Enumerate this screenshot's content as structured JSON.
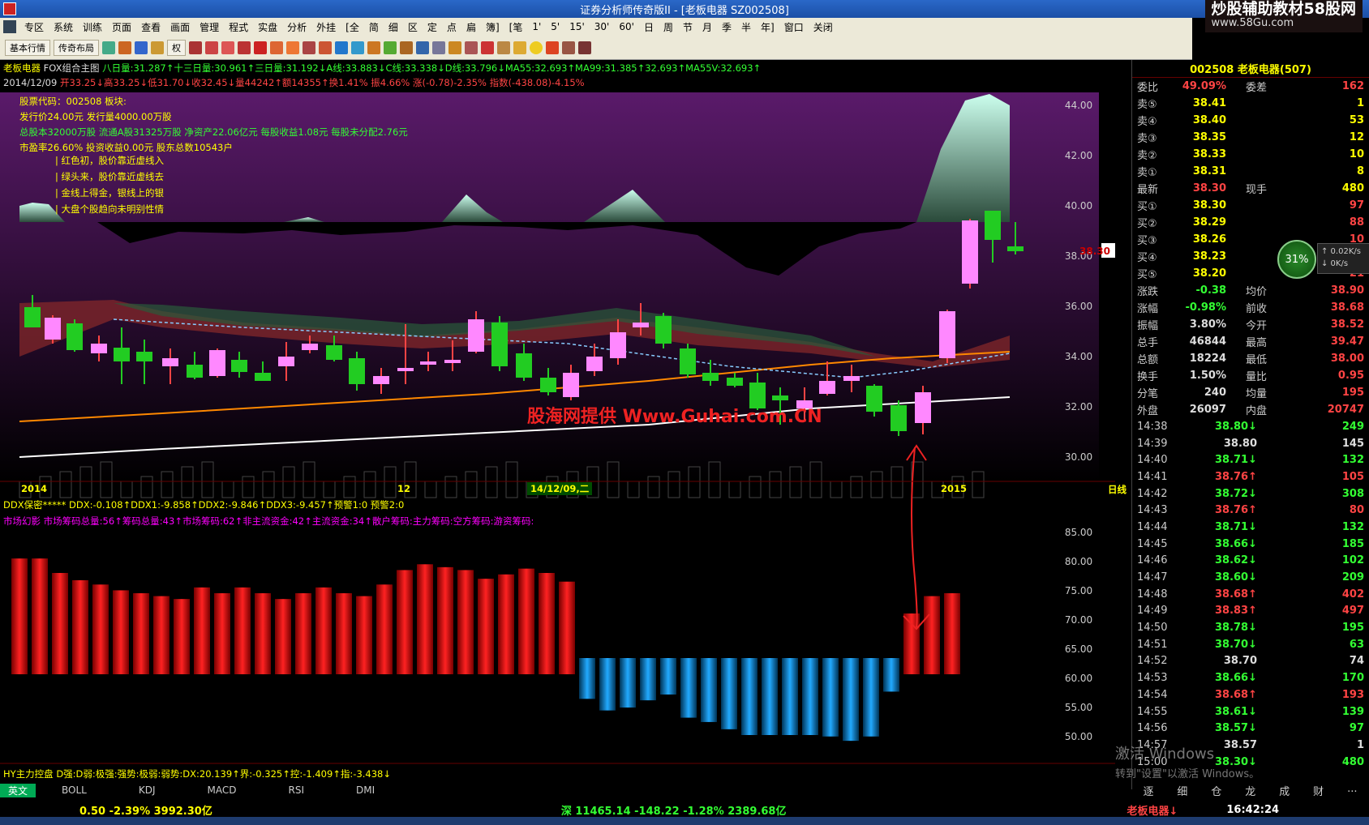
{
  "window": {
    "title": "证券分析师传奇版II - [老板电器 SZ002508]"
  },
  "watermark": {
    "line1": "炒股辅助教材58股网",
    "line2": "www.58Gu.com"
  },
  "menu": [
    "专区",
    "系统",
    "训练",
    "页面",
    "查看",
    "画面",
    "管理",
    "程式",
    "实盘",
    "分析",
    "外挂",
    "[全",
    "简",
    "细",
    "区",
    "定",
    "点",
    "扁",
    "簿]",
    "[笔",
    "1'",
    "5'",
    "15'",
    "30'",
    "60'",
    "日",
    "周",
    "节",
    "月",
    "季",
    "半",
    "年]",
    "窗口",
    "关闭"
  ],
  "toolbar": {
    "basic_label": "基本行情",
    "layout_label": "传奇布局",
    "quan_label": "权"
  },
  "chart_header": {
    "stock_name": "老板电器",
    "indicator_name": "FOX组合主图",
    "ma_line": "八日量:31.287↑十三日量:30.961↑三日量:31.192↓A线:33.883↓C线:33.338↓D线:33.796↓MA55:32.693↑MA99:31.385↑32.693↑MA55V:32.693↑",
    "date": "2014/12/09",
    "ohlc": "开33.25↓高33.25↓低31.70↓收32.45↓量44242↑额14355↑换1.41% 振4.66% 涨(-0.78)-2.35% 指数(-438.08)-4.15%"
  },
  "stock_info": {
    "code_line": "股票代码：002508 板块:",
    "issue_line": "发行价24.00元   发行量4000.00万股",
    "capital_line": "总股本32000万股   流通A股31325万股   净资产22.06亿元   每股收益1.08元   每股未分配2.76元",
    "pe_line": "市盈率26.60%   投资收益0.00元   股东总数10543户"
  },
  "tips": [
    "红色初，股价靠近虚线入",
    "绿头来，股价靠近虚线去",
    "金线上得金，银线上的银",
    "大盘个股趋向未明别性情"
  ],
  "site_watermark": "股海网提供 Www.Guhai.com.CN",
  "price_axis": [
    "44.00",
    "42.00",
    "40.00",
    "38.00",
    "36.00",
    "34.00",
    "32.00",
    "30.00"
  ],
  "current_price_tag": "38.30",
  "date_axis": {
    "left": "2014",
    "mid": "12",
    "cursor": "14/12/09,二",
    "right": "2015",
    "period": "日线"
  },
  "ddx_header": "DDX保密*****  DDX:-0.108↑DDX1:-9.858↑DDX2:-9.846↑DDX3:-9.457↑预警1:0 预警2:0",
  "market_header": "市场幻影 市场筹码总量:56↑筹码总量:43↑市场筹码:62↑非主流资金:42↑主流资金:34↑散户筹码:主力筹码:空方筹码:游资筹码:",
  "sub_axis": [
    "85.00",
    "80.00",
    "75.00",
    "70.00",
    "65.00",
    "60.00",
    "55.00",
    "50.00"
  ],
  "hy_header": "HY主力控盘 D强:D弱:极强:强势:极弱:弱势:DX:20.139↑界:-0.325↑控:-1.409↑指:-3.438↓",
  "bottom_tabs": [
    "英文",
    "BOLL",
    "KDJ",
    "MACD",
    "RSI",
    "DMI"
  ],
  "quote": {
    "title": "002508 老板电器(507)",
    "webi_label": "委比",
    "webi": "49.09%",
    "wecha_label": "委差",
    "wecha": "162",
    "asks": [
      [
        "卖⑤",
        "38.41",
        "1"
      ],
      [
        "卖④",
        "38.40",
        "53"
      ],
      [
        "卖③",
        "38.35",
        "12"
      ],
      [
        "卖②",
        "38.33",
        "10"
      ],
      [
        "卖①",
        "38.31",
        "8"
      ]
    ],
    "last_label": "最新",
    "last": "38.30",
    "hand_label": "现手",
    "hand": "480",
    "bids": [
      [
        "买①",
        "38.30",
        "97"
      ],
      [
        "买②",
        "38.29",
        "88"
      ],
      [
        "买③",
        "38.26",
        "10"
      ],
      [
        "买④",
        "38.23",
        "20"
      ],
      [
        "买⑤",
        "38.20",
        "21"
      ]
    ],
    "stats": [
      [
        "涨跌",
        "-0.38",
        "均价",
        "38.90"
      ],
      [
        "涨幅",
        "-0.98%",
        "前收",
        "38.68"
      ],
      [
        "振幅",
        "3.80%",
        "今开",
        "38.52"
      ],
      [
        "总手",
        "46844",
        "最高",
        "39.47"
      ],
      [
        "总额",
        "18224",
        "最低",
        "38.00"
      ],
      [
        "换手",
        "1.50%",
        "量比",
        "0.95"
      ],
      [
        "分笔",
        "240",
        "均量",
        "195"
      ],
      [
        "外盘",
        "26097",
        "内盘",
        "20747"
      ]
    ],
    "ticks": [
      [
        "14:38",
        "38.80↓",
        "249"
      ],
      [
        "14:39",
        "38.80",
        "145"
      ],
      [
        "14:40",
        "38.71↓",
        "132"
      ],
      [
        "14:41",
        "38.76↑",
        "105"
      ],
      [
        "14:42",
        "38.72↓",
        "308"
      ],
      [
        "14:43",
        "38.76↑",
        "80"
      ],
      [
        "14:44",
        "38.71↓",
        "132"
      ],
      [
        "14:45",
        "38.66↓",
        "185"
      ],
      [
        "14:46",
        "38.62↓",
        "102"
      ],
      [
        "14:47",
        "38.60↓",
        "209"
      ],
      [
        "14:48",
        "38.68↑",
        "402"
      ],
      [
        "14:49",
        "38.83↑",
        "497"
      ],
      [
        "14:50",
        "38.78↓",
        "195"
      ],
      [
        "14:51",
        "38.70↓",
        "63"
      ],
      [
        "14:52",
        "38.70",
        "74"
      ],
      [
        "14:53",
        "38.66↓",
        "170"
      ],
      [
        "14:54",
        "38.68↑",
        "193"
      ],
      [
        "14:55",
        "38.61↓",
        "139"
      ],
      [
        "14:56",
        "38.57↓",
        "97"
      ],
      [
        "14:57",
        "38.57",
        "1"
      ],
      [
        "15:00",
        "38.30↓",
        "480"
      ]
    ],
    "gauge": "31%",
    "speed1": "↑ 0.02K/s",
    "speed2": "↓ 0K/s",
    "tabs": [
      "逐",
      "细",
      "仓",
      "龙",
      "成",
      "财",
      "..."
    ]
  },
  "activate": {
    "line1": "激活 Windows",
    "line2": "转到\"设置\"以激活 Windows。"
  },
  "status": {
    "sh": "0.50 -2.39% 3992.30亿",
    "sz": "深 11465.14 -148.22 -1.28% 2389.68亿",
    "right": "老板电器↓",
    "time": "16:42:24"
  }
}
